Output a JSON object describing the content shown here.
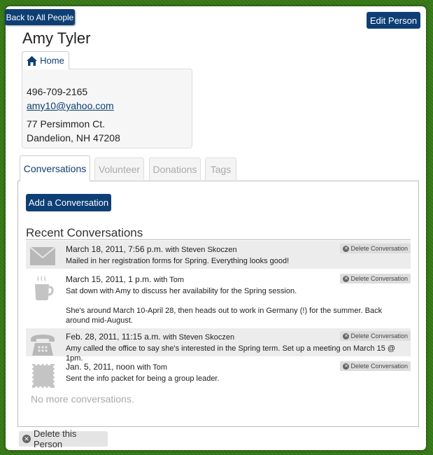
{
  "header": {
    "back_label": "Back to All People",
    "edit_label": "Edit Person",
    "person_name": "Amy Tyler"
  },
  "home_tab": {
    "label": "Home",
    "icon": "home-icon"
  },
  "contact": {
    "phone": "496-709-2165",
    "email": "amy10@yahoo.com",
    "address_line1": "77 Persimmon Ct.",
    "address_line2": "Dandelion, NH 47208"
  },
  "tabs": [
    {
      "label": "Conversations",
      "active": true
    },
    {
      "label": "Volunteer",
      "active": false
    },
    {
      "label": "Donations",
      "active": false
    },
    {
      "label": "Tags",
      "active": false
    }
  ],
  "conversations_panel": {
    "add_label": "Add a Conversation",
    "recent_title": "Recent Conversations",
    "delete_label": "Delete Conversation",
    "no_more": "No more conversations.",
    "items": [
      {
        "icon": "envelope-icon",
        "date": "March 18, 2011, 7:56 p.m.",
        "with": "with Steven Skoczen",
        "text1": "Mailed in her registration forms for Spring. Everything looks good!",
        "text2": ""
      },
      {
        "icon": "coffee-cup-icon",
        "date": "March 15, 2011, 1 p.m.",
        "with": "with Tom",
        "text1": "Sat down with Amy to discuss her availability for the Spring session.",
        "text2": "She's around March 10-April 28, then heads out to work in Germany (!) for the summer. Back around mid-August."
      },
      {
        "icon": "telephone-icon",
        "date": "Feb. 28, 2011, 11:15 a.m.",
        "with": "with Steven Skoczen",
        "text1": "Amy called the office to say she's interested in the Spring term. Set up a meeting on March 15 @ 1pm.",
        "text2": ""
      },
      {
        "icon": "stamp-icon",
        "date": "Jan. 5, 2011, noon",
        "with": "with Tom",
        "text1": "Sent the info packet for being a group leader.",
        "text2": ""
      }
    ]
  },
  "footer": {
    "delete_person_label": "Delete this Person"
  },
  "colors": {
    "accent": "#0d3f75",
    "background_green": "#3a7a1a"
  }
}
